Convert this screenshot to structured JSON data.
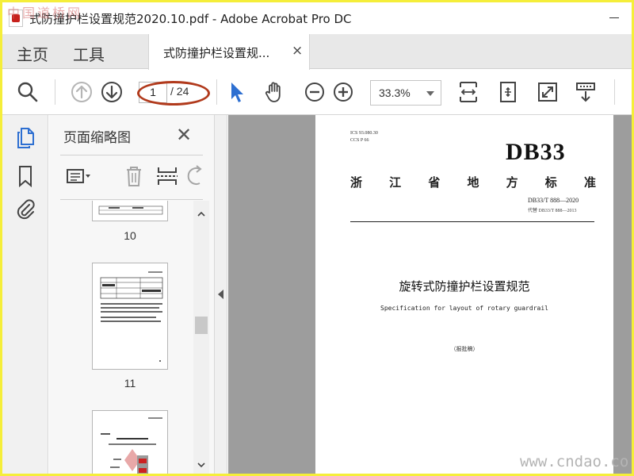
{
  "window": {
    "title": "式防撞护栏设置规范2020.10.pdf - Adobe Acrobat Pro DC"
  },
  "tabs": {
    "home": "主页",
    "tools": "工具",
    "document": "式防撞护栏设置规...",
    "close_glyph": "×"
  },
  "toolbar": {
    "page_current": "1",
    "page_total": "/ 24",
    "zoom": "33.3%"
  },
  "panel": {
    "title": "页面缩略图",
    "close_glyph": "✕",
    "thumbnails": [
      {
        "page": "10"
      },
      {
        "page": "11"
      }
    ]
  },
  "document": {
    "ics": "ICS  93.080.30",
    "ccs": "CCS  P 66",
    "db": "DB33",
    "standard_chars": [
      "浙",
      "江",
      "省",
      "地",
      "方",
      "标",
      "准"
    ],
    "code": "DB33/T  888—2020",
    "replaces": "代替 DB33/T 888—2013",
    "title": "旋转式防撞护栏设置规范",
    "subtitle": "Specification for layout of rotary guardrail",
    "draft": "（报批稿）"
  },
  "watermarks": {
    "top_left": "中国道桥网",
    "bottom_right": "www.cndao.co"
  },
  "colors": {
    "accent_blue": "#2d6fd1",
    "annotation_red": "#b13a1c",
    "doc_bg": "#9d9d9d",
    "frame_yellow": "#f5ee3a"
  }
}
